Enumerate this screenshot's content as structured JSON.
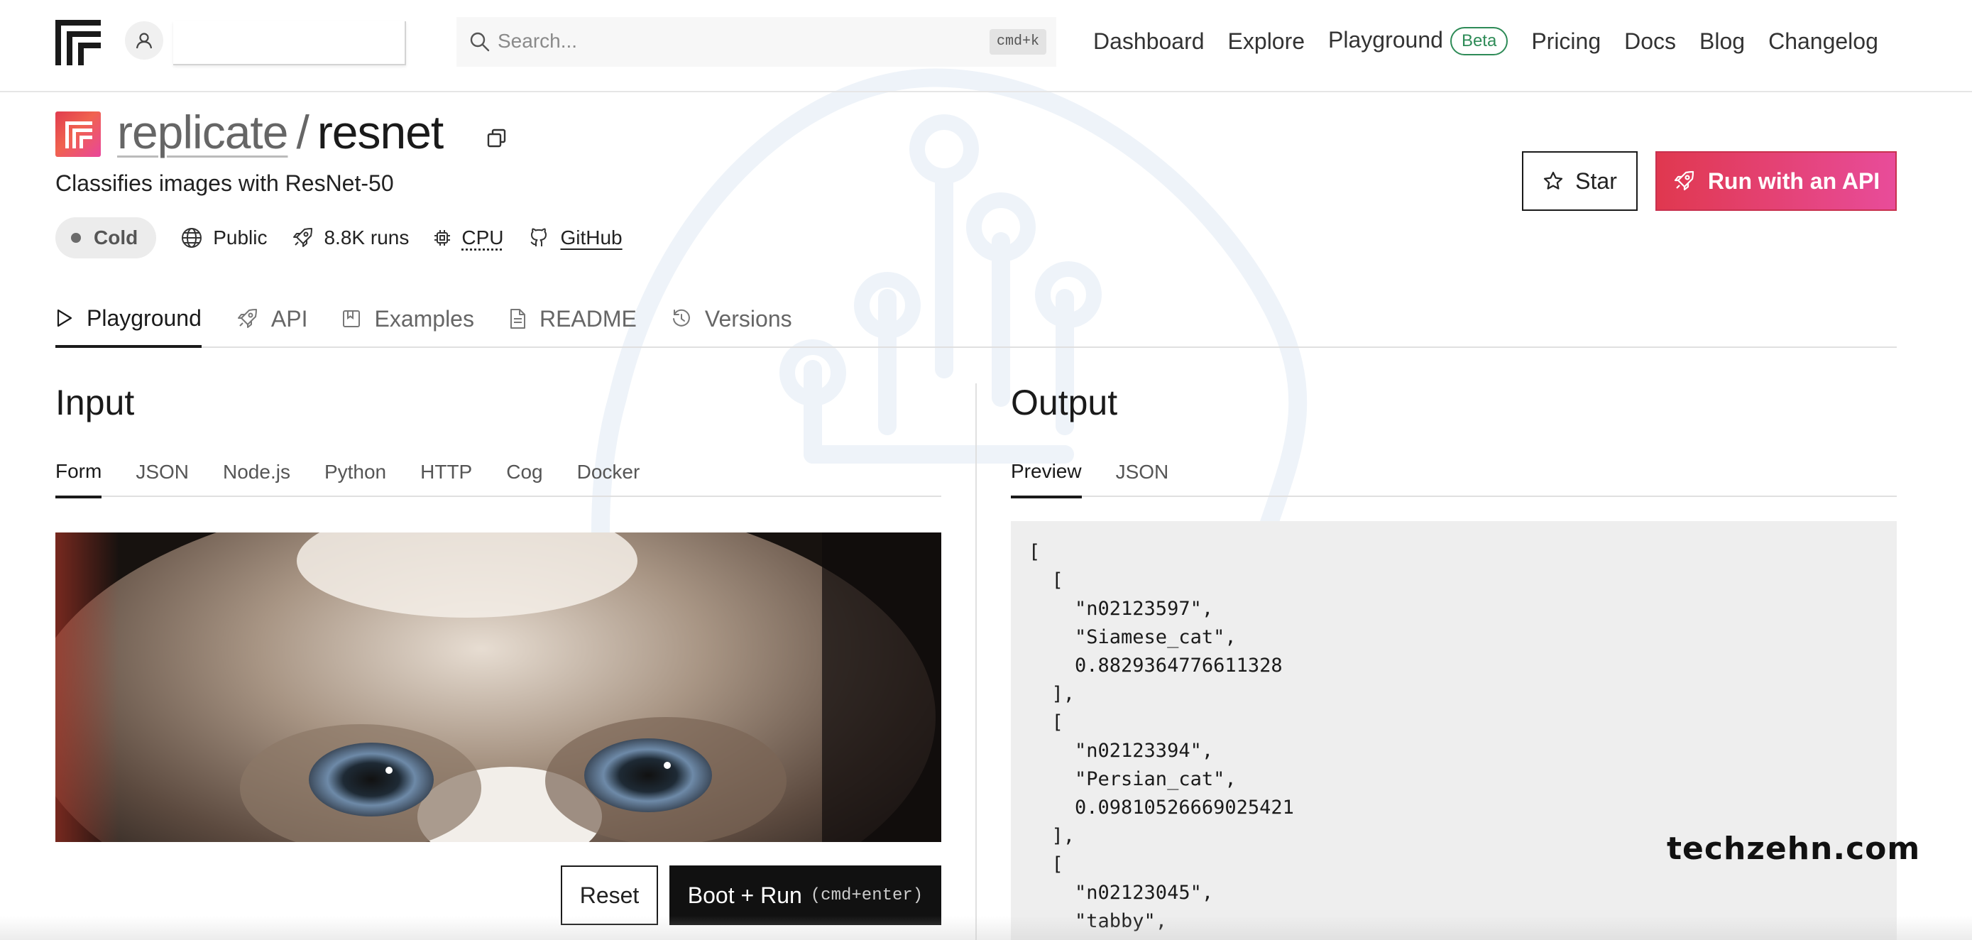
{
  "header": {
    "search_placeholder": "Search...",
    "search_shortcut": "cmd+k",
    "nav": {
      "dashboard": "Dashboard",
      "explore": "Explore",
      "playground": "Playground",
      "beta_badge": "Beta",
      "pricing": "Pricing",
      "docs": "Docs",
      "blog": "Blog",
      "changelog": "Changelog"
    }
  },
  "model": {
    "owner": "replicate",
    "separator": "/",
    "name": "resnet",
    "description": "Classifies images with ResNet-50",
    "status": "Cold",
    "visibility": "Public",
    "runs": "8.8K runs",
    "hardware": "CPU",
    "github": "GitHub",
    "star_label": "Star",
    "api_label": "Run with an API"
  },
  "tabs": {
    "playground": "Playground",
    "api": "API",
    "examples": "Examples",
    "readme": "README",
    "versions": "Versions"
  },
  "input": {
    "title": "Input",
    "subtabs": {
      "form": "Form",
      "json": "JSON",
      "nodejs": "Node.js",
      "python": "Python",
      "http": "HTTP",
      "cog": "Cog",
      "docker": "Docker"
    },
    "reset_label": "Reset",
    "run_label": "Boot + Run",
    "run_hint": "(cmd+enter)"
  },
  "output": {
    "title": "Output",
    "subtabs": {
      "preview": "Preview",
      "json": "JSON"
    },
    "json_text": "[\n  [\n    \"n02123597\",\n    \"Siamese_cat\",\n    0.8829364776611328\n  ],\n  [\n    \"n02123394\",\n    \"Persian_cat\",\n    0.09810526669025421\n  ],\n  [\n    \"n02123045\",\n    \"tabby\","
  },
  "watermark": {
    "site": "techzehn.com"
  },
  "colors": {
    "accent_start": "#e0384f",
    "accent_end": "#e84c9a",
    "beta_green": "#2e8b57"
  }
}
